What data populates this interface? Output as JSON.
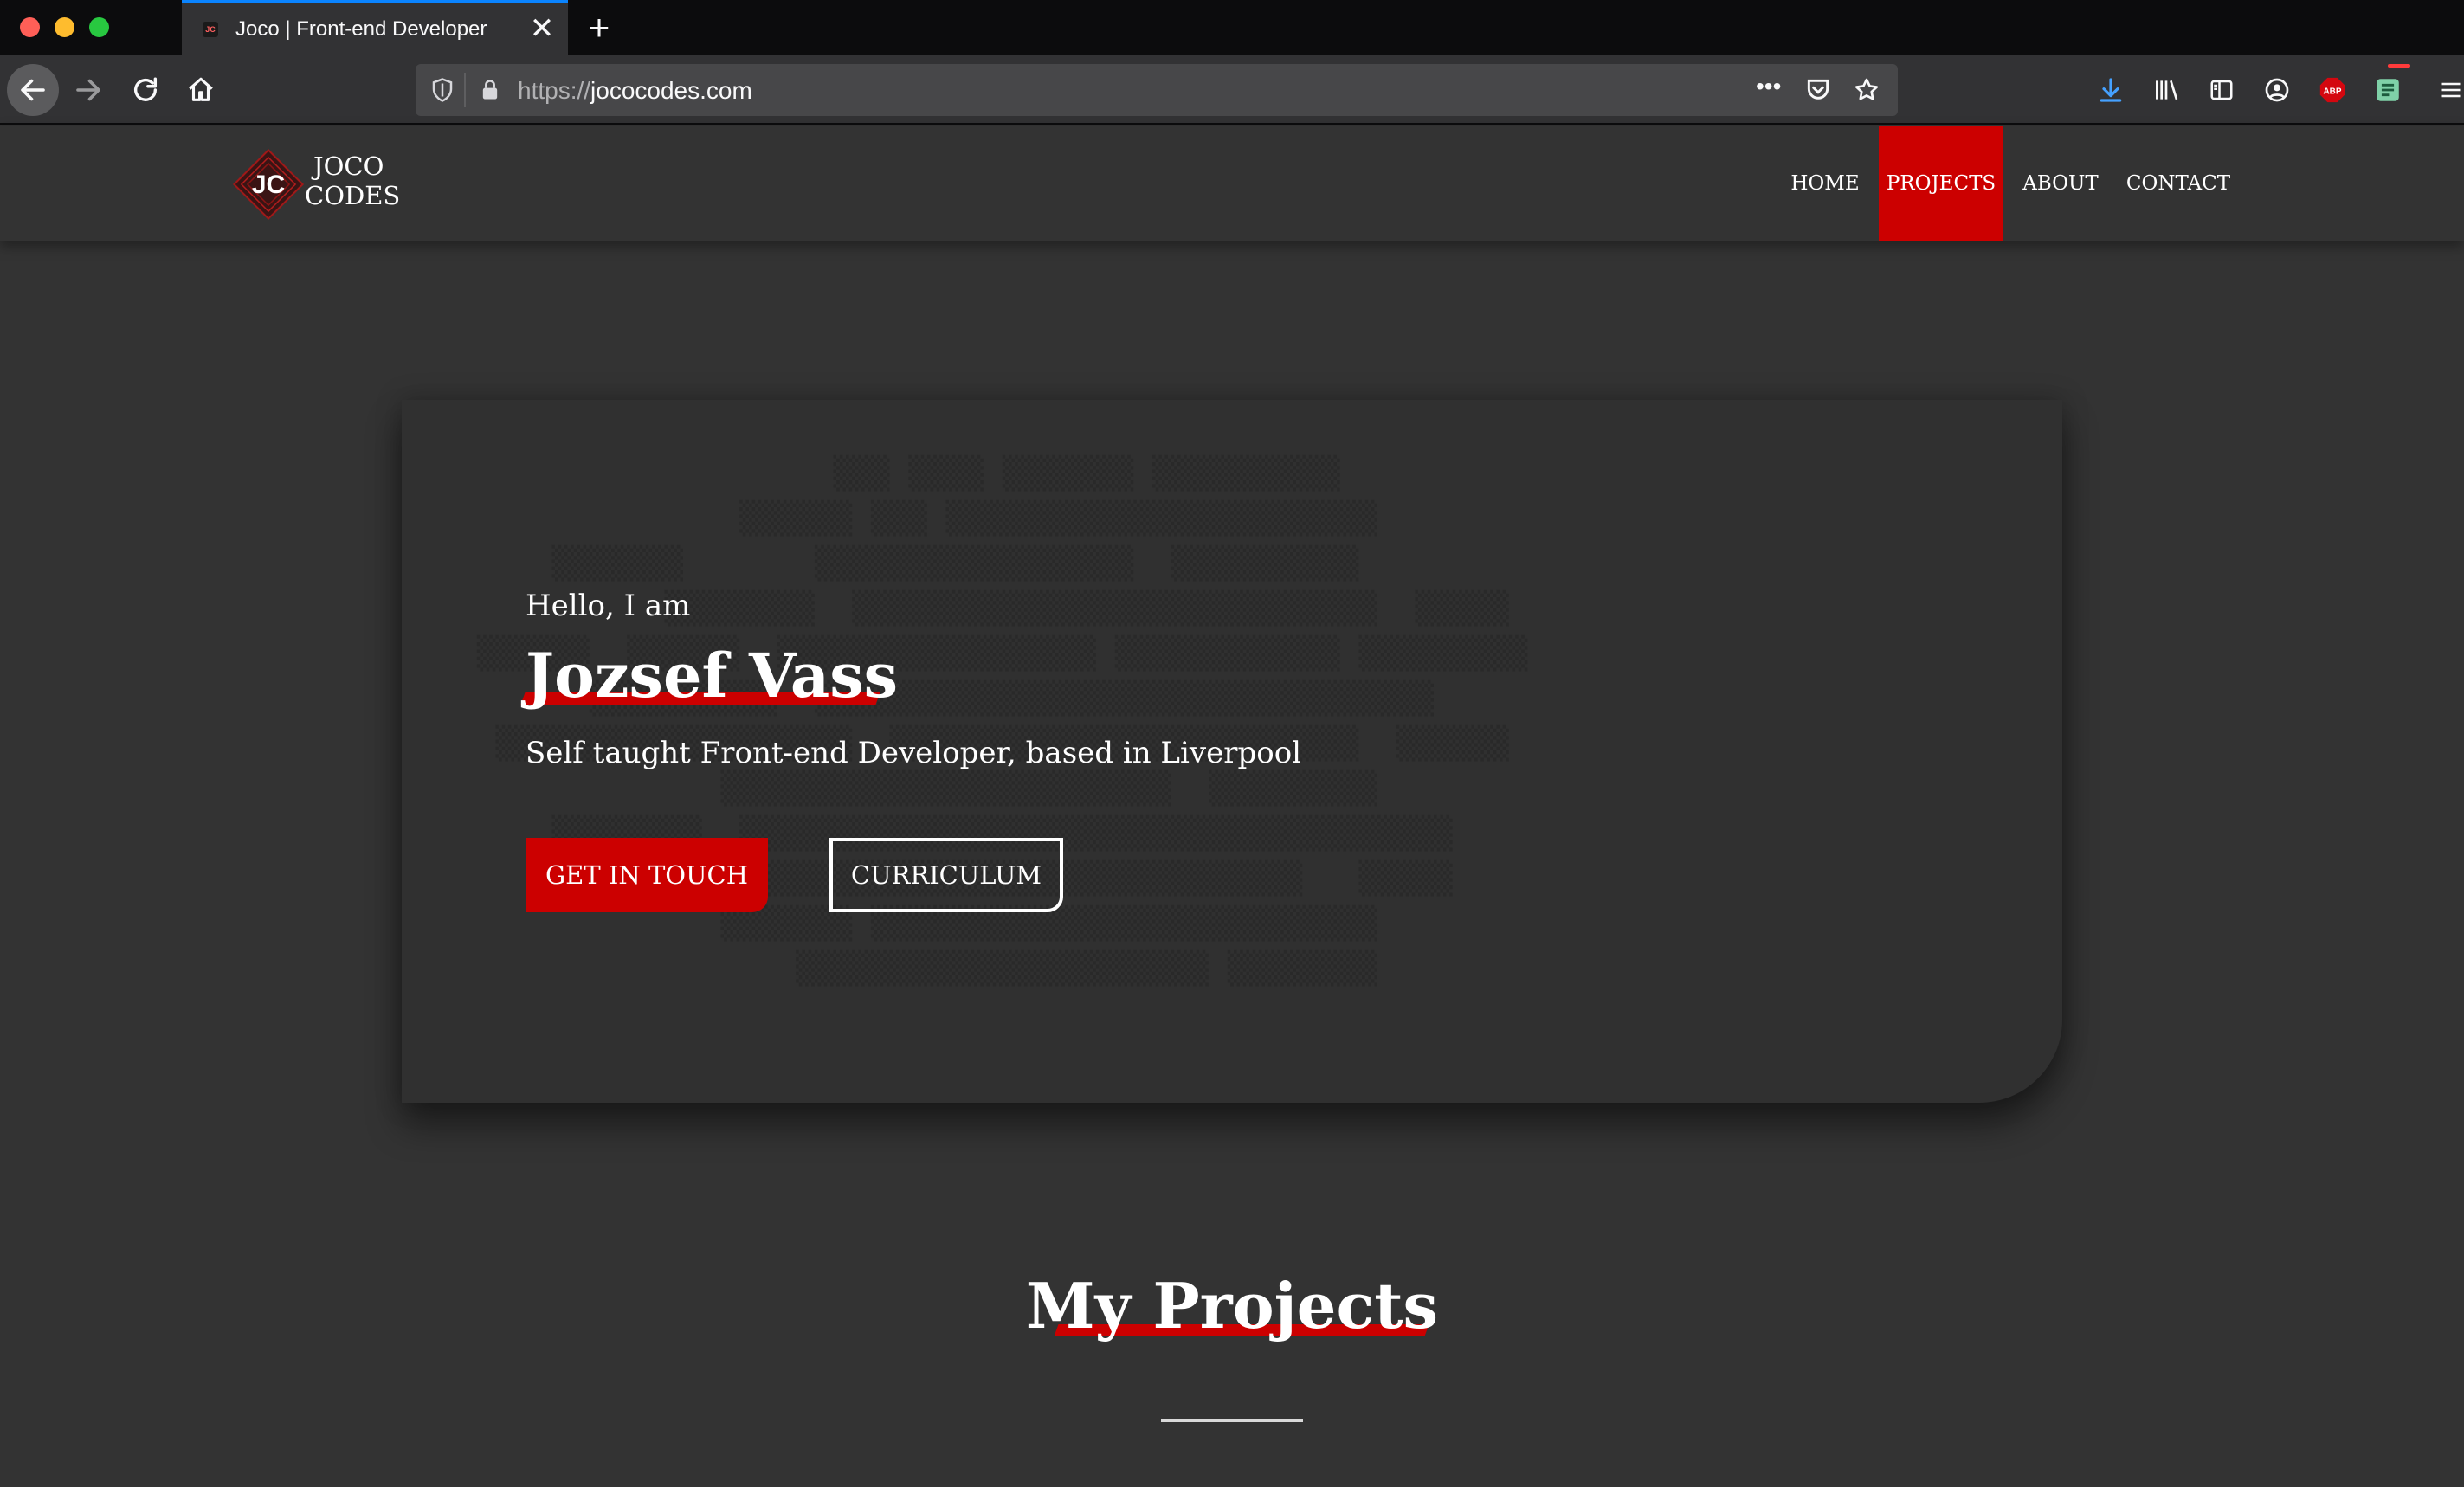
{
  "browser": {
    "tab_title": "Joco | Front-end Developer",
    "tab_favicon": "JC",
    "new_tab_label": "+",
    "close_tab_label": "✕",
    "url_protocol": "https://",
    "url_host": "jococodes.com",
    "more_label": "•••",
    "adblock_label": "ABP"
  },
  "site": {
    "logo_mark": "JC",
    "logo_line1": "JOCO",
    "logo_line2": "CODES",
    "nav": [
      {
        "label": "HOME",
        "active": false
      },
      {
        "label": "PROJECTS",
        "active": true
      },
      {
        "label": "ABOUT",
        "active": false
      },
      {
        "label": "CONTACT",
        "active": false
      }
    ],
    "accent_color": "#cc0000"
  },
  "hero": {
    "greeting": "Hello, I am",
    "name": "Jozsef Vass",
    "tagline": "Self taught Front-end Developer, based in Liverpool",
    "cta_primary": "GET IN TOUCH",
    "cta_secondary": "CURRICULUM"
  },
  "projects": {
    "title": "My Projects"
  }
}
